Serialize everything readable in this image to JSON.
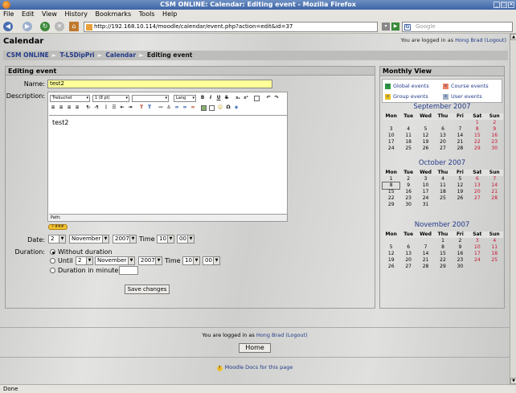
{
  "window": {
    "title": "CSM ONLINE: Calendar: Editing event - Mozilla Firefox"
  },
  "menu": [
    "File",
    "Edit",
    "View",
    "History",
    "Bookmarks",
    "Tools",
    "Help"
  ],
  "nav": {
    "url": "http://192.168.10.114/moodle/calendar/event.php?action=edit&id=37",
    "search_placeholder": "Google"
  },
  "header": {
    "title": "Calendar",
    "login_prefix": "You are logged in as",
    "user": "Hong Brad",
    "logout": "(Logout)"
  },
  "breadcrumb": [
    "CSM ONLINE",
    "T-L5DipPri",
    "Calendar",
    "Editing event"
  ],
  "breadcrumb_sep": "►",
  "form": {
    "heading": "Editing event",
    "name_label": "Name:",
    "name_value": "test2",
    "description_label": "Description:",
    "editor": {
      "font": "Trebuchet",
      "size": "1 (8 pt)",
      "format": "",
      "lang": "Lang",
      "content": "test2",
      "path_label": "Path:",
      "help_badge": "? ###"
    },
    "date_label": "Date:",
    "date": {
      "day": "2",
      "month": "November",
      "year": "2007",
      "time_label": "Time",
      "hour": "10",
      "minute": "00"
    },
    "duration_label": "Duration:",
    "duration_none": "Without duration",
    "duration_until": "Until",
    "until": {
      "day": "2",
      "month": "November",
      "year": "2007",
      "time_label": "Time",
      "hour": "10",
      "minute": "00"
    },
    "duration_minutes": "Duration in minutes:",
    "save": "Save changes"
  },
  "monthly": {
    "heading": "Monthly View",
    "legend": {
      "global": "Global events",
      "course": "Course events",
      "group": "Group events",
      "user": "User events",
      "colors": {
        "global": "#2e9a3e",
        "course": "#f08060",
        "group": "#e8c020",
        "user": "#a0b0c8"
      }
    },
    "days": [
      "Mon",
      "Tue",
      "Wed",
      "Thu",
      "Fri",
      "Sat",
      "Sun"
    ],
    "months": [
      {
        "title": "September 2007",
        "rows": [
          [
            "",
            "",
            "",
            "",
            "",
            "1",
            "2"
          ],
          [
            "3",
            "4",
            "5",
            "6",
            "7",
            "8",
            "9"
          ],
          [
            "10",
            "11",
            "12",
            "13",
            "14",
            "15",
            "16"
          ],
          [
            "17",
            "18",
            "19",
            "20",
            "21",
            "22",
            "23"
          ],
          [
            "24",
            "25",
            "26",
            "27",
            "28",
            "29",
            "30"
          ]
        ]
      },
      {
        "title": "October 2007",
        "rows": [
          [
            "1",
            "2",
            "3",
            "4",
            "5",
            "6",
            "7"
          ],
          [
            "8",
            "9",
            "10",
            "11",
            "12",
            "13",
            "14"
          ],
          [
            "15",
            "16",
            "17",
            "18",
            "19",
            "20",
            "21"
          ],
          [
            "22",
            "23",
            "24",
            "25",
            "26",
            "27",
            "28"
          ],
          [
            "29",
            "30",
            "31",
            "",
            "",
            "",
            ""
          ]
        ]
      },
      {
        "title": "November 2007",
        "rows": [
          [
            "",
            "",
            "",
            "1",
            "2",
            "3",
            "4"
          ],
          [
            "5",
            "6",
            "7",
            "8",
            "9",
            "10",
            "11"
          ],
          [
            "12",
            "13",
            "14",
            "15",
            "16",
            "17",
            "18"
          ],
          [
            "19",
            "20",
            "21",
            "22",
            "23",
            "24",
            "25"
          ],
          [
            "26",
            "27",
            "28",
            "29",
            "30",
            "",
            ""
          ]
        ]
      }
    ],
    "today": "8"
  },
  "footer": {
    "login_prefix": "You are logged in as",
    "user": "Hong Brad",
    "logout": "(Logout)",
    "home": "Home",
    "docs": "Moodle Docs for this page"
  },
  "status": "Done"
}
